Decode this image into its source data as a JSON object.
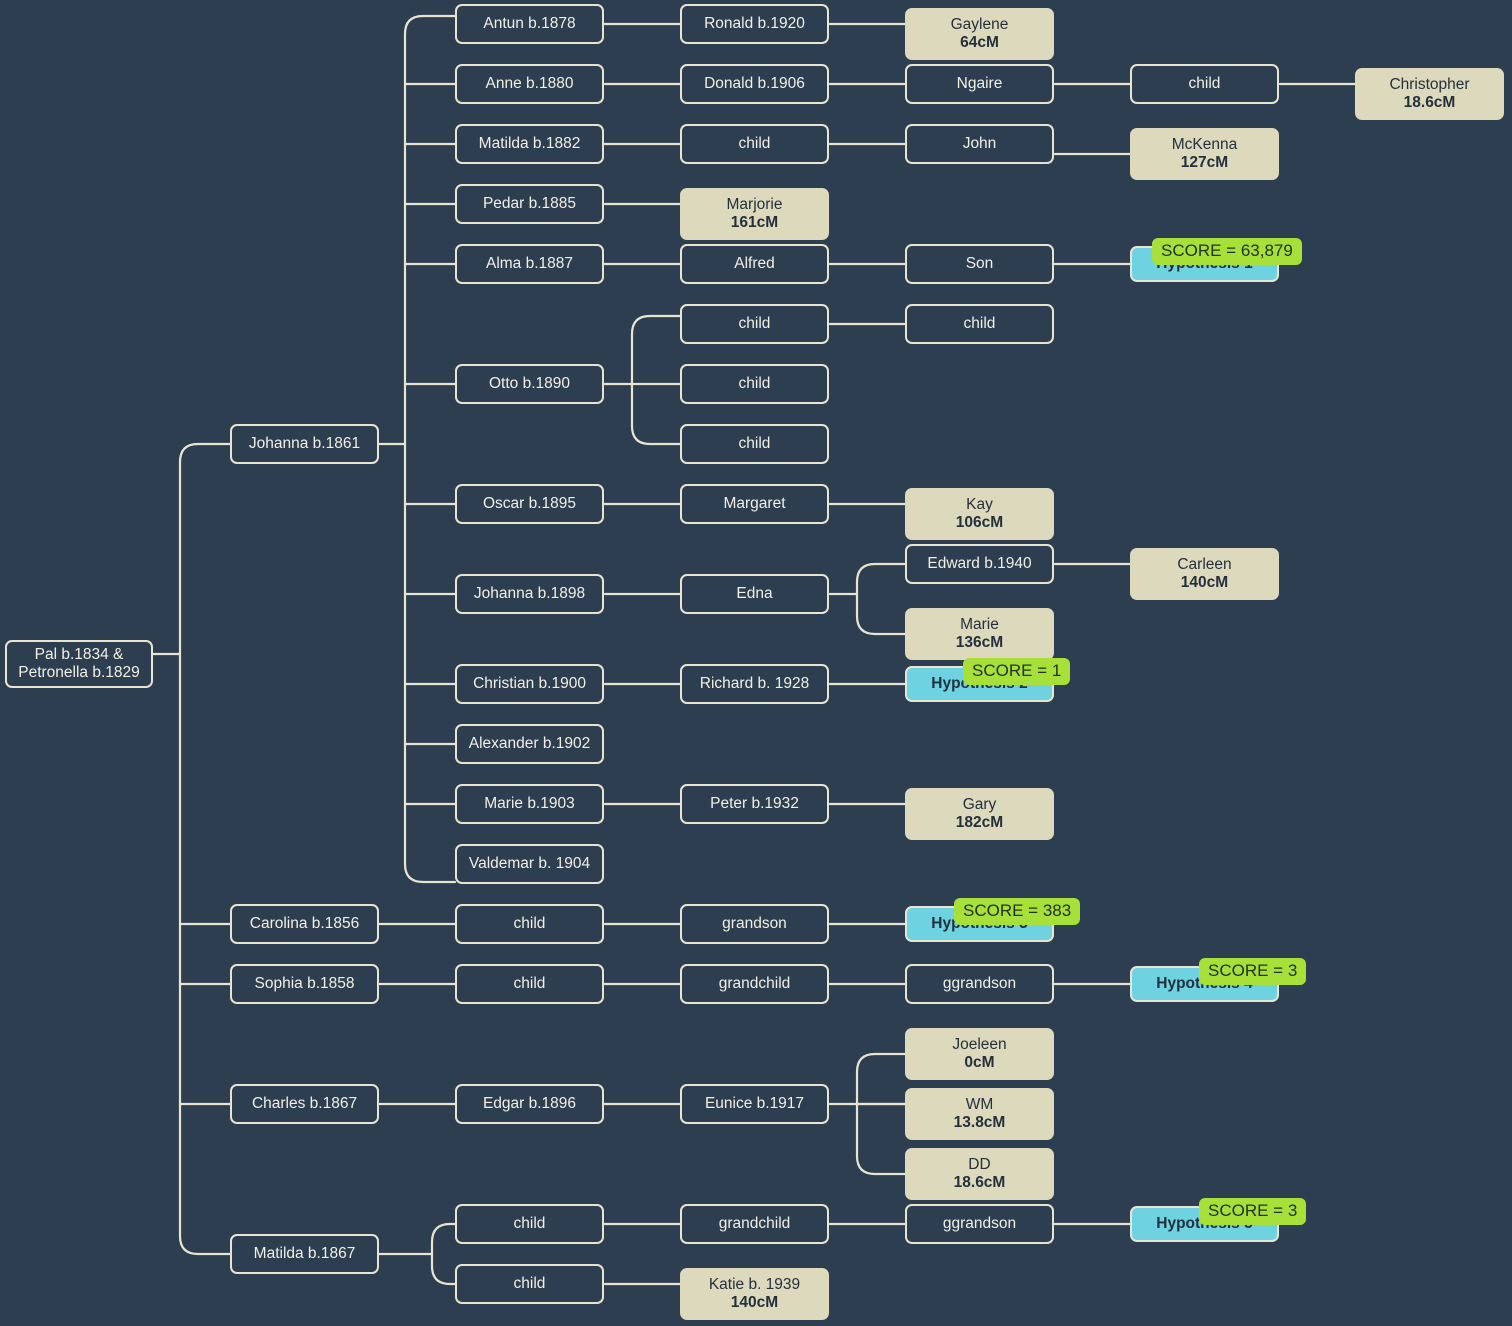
{
  "diagram": {
    "title": "Descendant tree with DNA match cM values and hypothesis scores",
    "background_color": "#2c3e50",
    "colors": {
      "node_border": "#e8e4d0",
      "node_text": "#f2efe4",
      "match_fill": "#dcd9bc",
      "hypothesis_fill": "#6fd2e0",
      "score_fill": "#a6e038",
      "link": "#e8e4d0"
    }
  },
  "root": {
    "line1": "Pal b.1834 &",
    "line2": "Petronella b.1829"
  },
  "nodes": {
    "antun": {
      "label": "Antun b.1878"
    },
    "ronald": {
      "label": "Ronald b.1920"
    },
    "gaylene": {
      "name": "Gaylene",
      "cm": "64cM"
    },
    "anne": {
      "label": "Anne b.1880"
    },
    "donald": {
      "label": "Donald b.1906"
    },
    "ngaire": {
      "label": "Ngaire"
    },
    "ngaire_child": {
      "label": "child"
    },
    "christopher": {
      "name": "Christopher",
      "cm": "18.6cM"
    },
    "matilda1882": {
      "label": "Matilda b.1882"
    },
    "matilda_child": {
      "label": "child"
    },
    "john": {
      "label": "John"
    },
    "mckenna": {
      "name": "McKenna",
      "cm": "127cM"
    },
    "pedar": {
      "label": "Pedar b.1885"
    },
    "marjorie": {
      "name": "Marjorie",
      "cm": "161cM"
    },
    "alma": {
      "label": "Alma b.1887"
    },
    "alfred": {
      "label": "Alfred"
    },
    "son": {
      "label": "Son"
    },
    "hypothesis1": {
      "label": "Hypothesis 1",
      "score": "SCORE = 63,879"
    },
    "otto": {
      "label": "Otto b.1890"
    },
    "otto_child1": {
      "label": "child"
    },
    "otto_gchild1": {
      "label": "child"
    },
    "otto_child2": {
      "label": "child"
    },
    "otto_child3": {
      "label": "child"
    },
    "oscar": {
      "label": "Oscar b.1895"
    },
    "margaret": {
      "label": "Margaret"
    },
    "kay": {
      "name": "Kay",
      "cm": "106cM"
    },
    "johanna1898": {
      "label": "Johanna b.1898"
    },
    "edna": {
      "label": "Edna"
    },
    "edward": {
      "label": "Edward b.1940"
    },
    "carleen": {
      "name": "Carleen",
      "cm": "140cM"
    },
    "marie_match": {
      "name": "Marie",
      "cm": "136cM"
    },
    "christian": {
      "label": "Christian b.1900"
    },
    "richard": {
      "label": "Richard b. 1928"
    },
    "hypothesis2": {
      "label": "Hypothesis 2",
      "score": "SCORE = 1"
    },
    "alexander": {
      "label": "Alexander b.1902"
    },
    "marie1903": {
      "label": "Marie b.1903"
    },
    "peter": {
      "label": "Peter b.1932"
    },
    "gary": {
      "name": "Gary",
      "cm": "182cM"
    },
    "valdemar": {
      "label": "Valdemar b. 1904"
    },
    "johanna1861": {
      "label": "Johanna b.1861"
    },
    "carolina": {
      "label": "Carolina b.1856"
    },
    "carolina_child": {
      "label": "child"
    },
    "carolina_grandson": {
      "label": "grandson"
    },
    "hypothesis3": {
      "label": "Hypothesis 3",
      "score": "SCORE = 383"
    },
    "sophia": {
      "label": "Sophia b.1858"
    },
    "sophia_child": {
      "label": "child"
    },
    "sophia_grandchild": {
      "label": "grandchild"
    },
    "sophia_ggrandson": {
      "label": "ggrandson"
    },
    "hypothesis4": {
      "label": "Hypothesis 4",
      "score": "SCORE = 3"
    },
    "charles": {
      "label": "Charles b.1867"
    },
    "edgar": {
      "label": "Edgar b.1896"
    },
    "eunice": {
      "label": "Eunice b.1917"
    },
    "joeleen": {
      "name": "Joeleen",
      "cm": "0cM"
    },
    "wm": {
      "name": "WM",
      "cm": "13.8cM"
    },
    "dd": {
      "name": "DD",
      "cm": "18.6cM"
    },
    "matilda1867": {
      "label": "Matilda b.1867"
    },
    "m_child1": {
      "label": "child"
    },
    "m_grandchild": {
      "label": "grandchild"
    },
    "m_ggrandson": {
      "label": "ggrandson"
    },
    "hypothesis5": {
      "label": "Hypothesis 5",
      "score": "SCORE = 3"
    },
    "m_child2": {
      "label": "child"
    },
    "katie": {
      "name": "Katie b. 1939",
      "cm": "140cM"
    }
  }
}
